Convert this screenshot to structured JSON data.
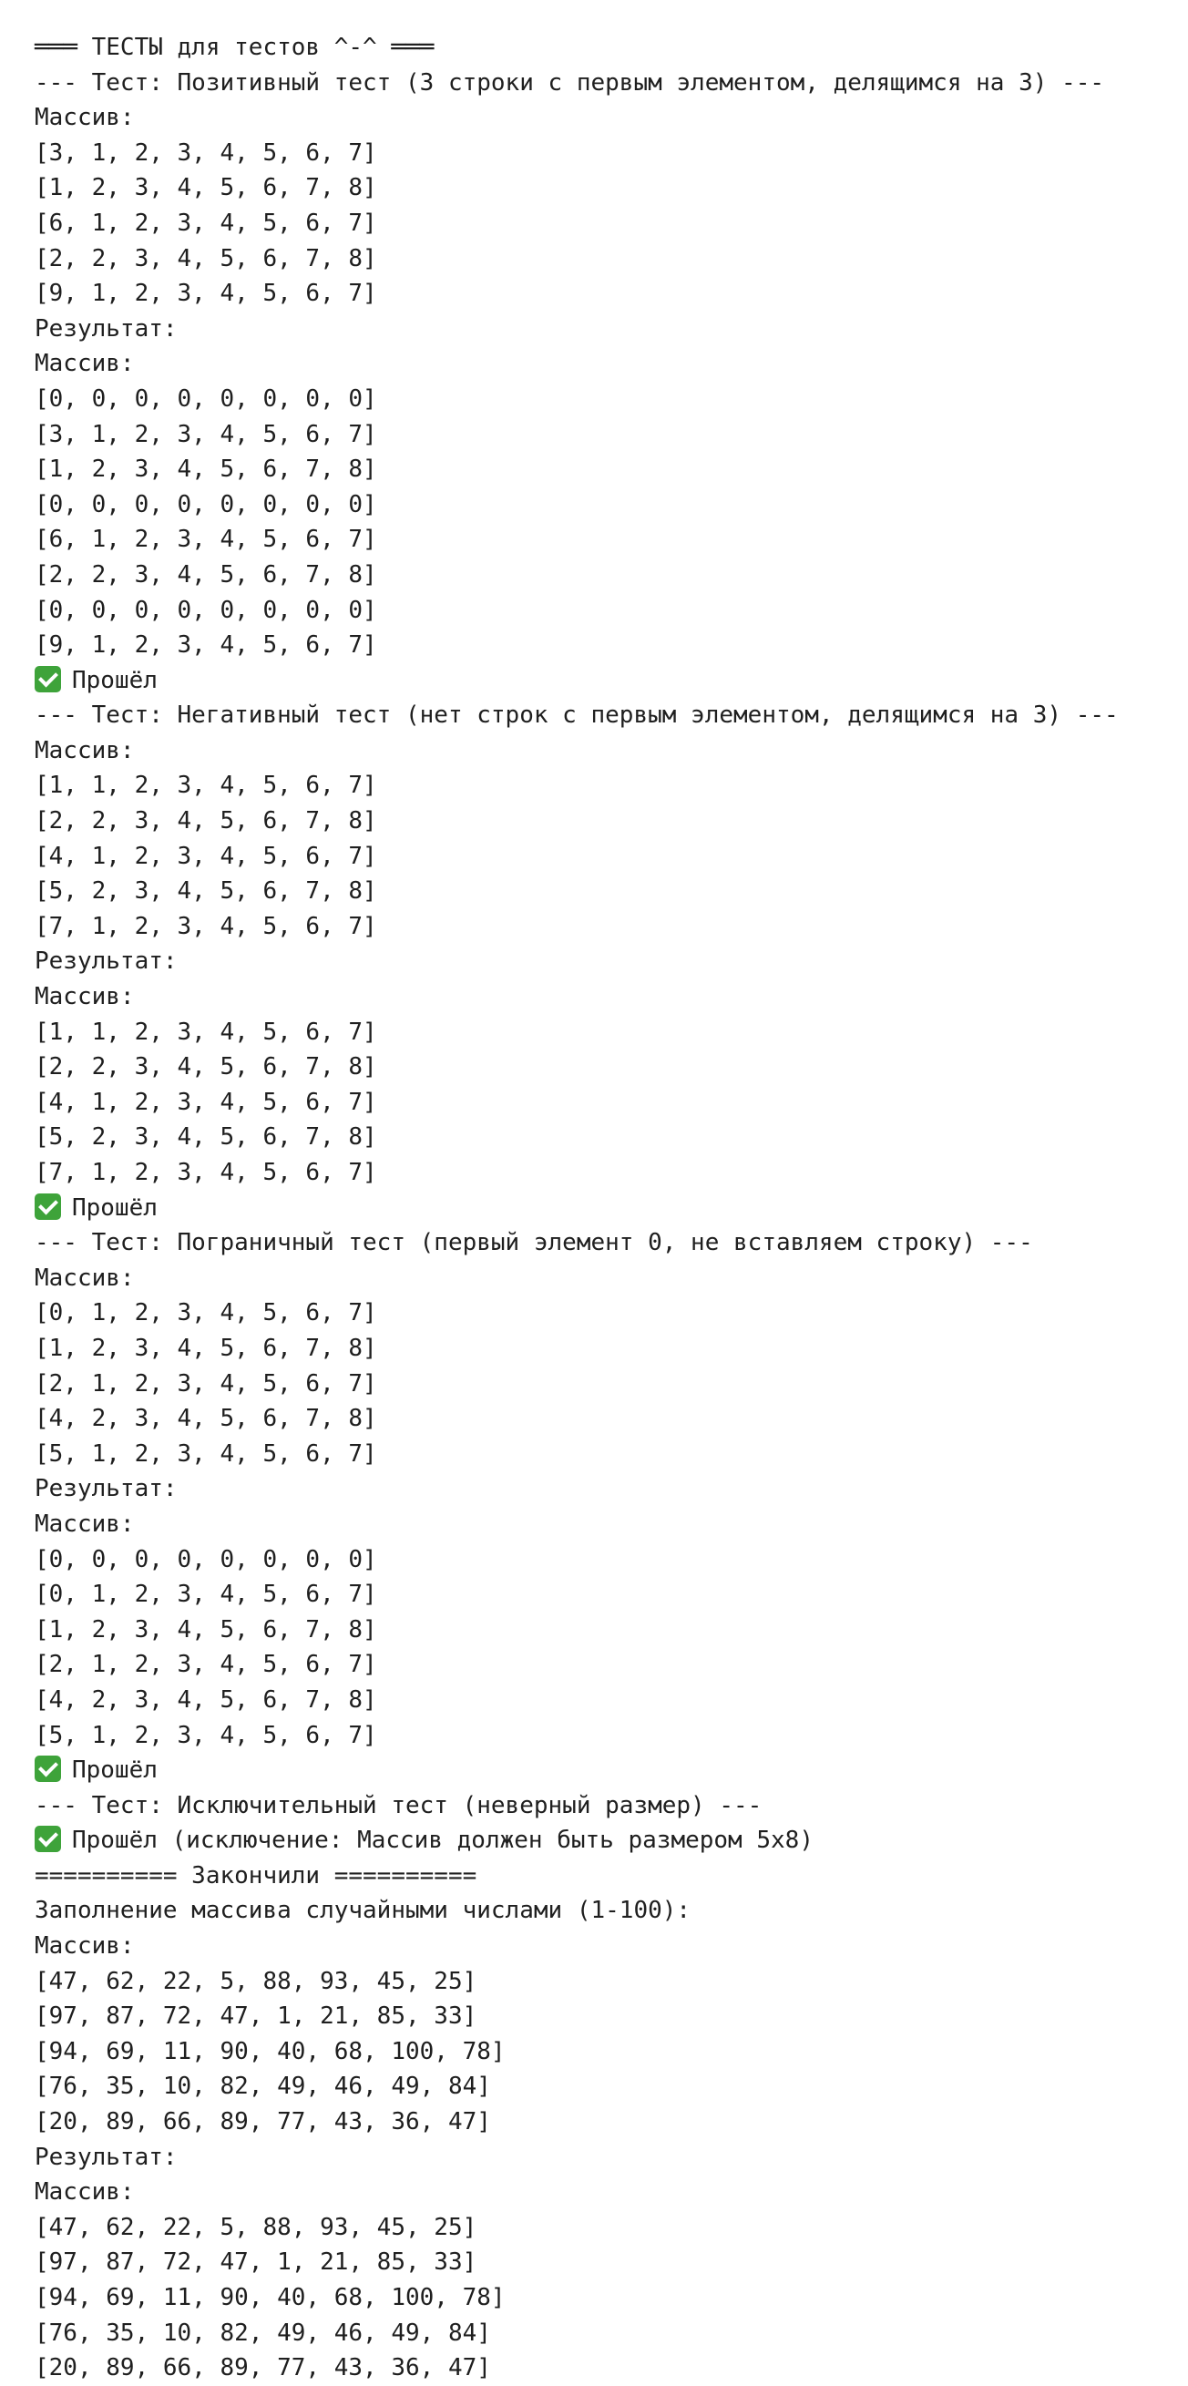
{
  "console": {
    "lines": [
      {
        "text": "═══ ТЕСТЫ для тестов ^-^ ═══",
        "kind": "header"
      },
      {
        "text": "--- Тест: Позитивный тест (3 строки с первым элементом, делящимся на 3) ---",
        "kind": "test-title"
      },
      {
        "text": "Массив:",
        "kind": "label"
      },
      {
        "text": "[3, 1, 2, 3, 4, 5, 6, 7]",
        "kind": "row"
      },
      {
        "text": "[1, 2, 3, 4, 5, 6, 7, 8]",
        "kind": "row"
      },
      {
        "text": "[6, 1, 2, 3, 4, 5, 6, 7]",
        "kind": "row"
      },
      {
        "text": "[2, 2, 3, 4, 5, 6, 7, 8]",
        "kind": "row"
      },
      {
        "text": "[9, 1, 2, 3, 4, 5, 6, 7]",
        "kind": "row"
      },
      {
        "text": "Результат:",
        "kind": "label"
      },
      {
        "text": "Массив:",
        "kind": "label"
      },
      {
        "text": "[0, 0, 0, 0, 0, 0, 0, 0]",
        "kind": "row"
      },
      {
        "text": "[3, 1, 2, 3, 4, 5, 6, 7]",
        "kind": "row"
      },
      {
        "text": "[1, 2, 3, 4, 5, 6, 7, 8]",
        "kind": "row"
      },
      {
        "text": "[0, 0, 0, 0, 0, 0, 0, 0]",
        "kind": "row"
      },
      {
        "text": "[6, 1, 2, 3, 4, 5, 6, 7]",
        "kind": "row"
      },
      {
        "text": "[2, 2, 3, 4, 5, 6, 7, 8]",
        "kind": "row"
      },
      {
        "text": "[0, 0, 0, 0, 0, 0, 0, 0]",
        "kind": "row"
      },
      {
        "text": "[9, 1, 2, 3, 4, 5, 6, 7]",
        "kind": "row"
      },
      {
        "text": "Прошёл",
        "kind": "pass",
        "icon": "check-icon"
      },
      {
        "text": "--- Тест: Негативный тест (нет строк с первым элементом, делящимся на 3) ---",
        "kind": "test-title"
      },
      {
        "text": "Массив:",
        "kind": "label"
      },
      {
        "text": "[1, 1, 2, 3, 4, 5, 6, 7]",
        "kind": "row"
      },
      {
        "text": "[2, 2, 3, 4, 5, 6, 7, 8]",
        "kind": "row"
      },
      {
        "text": "[4, 1, 2, 3, 4, 5, 6, 7]",
        "kind": "row"
      },
      {
        "text": "[5, 2, 3, 4, 5, 6, 7, 8]",
        "kind": "row"
      },
      {
        "text": "[7, 1, 2, 3, 4, 5, 6, 7]",
        "kind": "row"
      },
      {
        "text": "Результат:",
        "kind": "label"
      },
      {
        "text": "Массив:",
        "kind": "label"
      },
      {
        "text": "[1, 1, 2, 3, 4, 5, 6, 7]",
        "kind": "row"
      },
      {
        "text": "[2, 2, 3, 4, 5, 6, 7, 8]",
        "kind": "row"
      },
      {
        "text": "[4, 1, 2, 3, 4, 5, 6, 7]",
        "kind": "row"
      },
      {
        "text": "[5, 2, 3, 4, 5, 6, 7, 8]",
        "kind": "row"
      },
      {
        "text": "[7, 1, 2, 3, 4, 5, 6, 7]",
        "kind": "row"
      },
      {
        "text": "Прошёл",
        "kind": "pass",
        "icon": "check-icon"
      },
      {
        "text": "--- Тест: Пограничный тест (первый элемент 0, не вставляем строку) ---",
        "kind": "test-title"
      },
      {
        "text": "Массив:",
        "kind": "label"
      },
      {
        "text": "[0, 1, 2, 3, 4, 5, 6, 7]",
        "kind": "row"
      },
      {
        "text": "[1, 2, 3, 4, 5, 6, 7, 8]",
        "kind": "row"
      },
      {
        "text": "[2, 1, 2, 3, 4, 5, 6, 7]",
        "kind": "row"
      },
      {
        "text": "[4, 2, 3, 4, 5, 6, 7, 8]",
        "kind": "row"
      },
      {
        "text": "[5, 1, 2, 3, 4, 5, 6, 7]",
        "kind": "row"
      },
      {
        "text": "Результат:",
        "kind": "label"
      },
      {
        "text": "Массив:",
        "kind": "label"
      },
      {
        "text": "[0, 0, 0, 0, 0, 0, 0, 0]",
        "kind": "row"
      },
      {
        "text": "[0, 1, 2, 3, 4, 5, 6, 7]",
        "kind": "row"
      },
      {
        "text": "[1, 2, 3, 4, 5, 6, 7, 8]",
        "kind": "row"
      },
      {
        "text": "[2, 1, 2, 3, 4, 5, 6, 7]",
        "kind": "row"
      },
      {
        "text": "[4, 2, 3, 4, 5, 6, 7, 8]",
        "kind": "row"
      },
      {
        "text": "[5, 1, 2, 3, 4, 5, 6, 7]",
        "kind": "row"
      },
      {
        "text": "Прошёл",
        "kind": "pass",
        "icon": "check-icon"
      },
      {
        "text": "--- Тест: Исключительный тест (неверный размер) ---",
        "kind": "test-title"
      },
      {
        "text": "Прошёл (исключение: Массив должен быть размером 5x8)",
        "kind": "pass",
        "icon": "check-icon"
      },
      {
        "text": "========== Закончили ==========",
        "kind": "header"
      },
      {
        "text": "Заполнение массива случайными числами (1-100):",
        "kind": "label"
      },
      {
        "text": "Массив:",
        "kind": "label"
      },
      {
        "text": "[47, 62, 22, 5, 88, 93, 45, 25]",
        "kind": "row"
      },
      {
        "text": "[97, 87, 72, 47, 1, 21, 85, 33]",
        "kind": "row"
      },
      {
        "text": "[94, 69, 11, 90, 40, 68, 100, 78]",
        "kind": "row"
      },
      {
        "text": "[76, 35, 10, 82, 49, 46, 49, 84]",
        "kind": "row"
      },
      {
        "text": "[20, 89, 66, 89, 77, 43, 36, 47]",
        "kind": "row"
      },
      {
        "text": "Результат:",
        "kind": "label"
      },
      {
        "text": "Массив:",
        "kind": "label"
      },
      {
        "text": "[47, 62, 22, 5, 88, 93, 45, 25]",
        "kind": "row"
      },
      {
        "text": "[97, 87, 72, 47, 1, 21, 85, 33]",
        "kind": "row"
      },
      {
        "text": "[94, 69, 11, 90, 40, 68, 100, 78]",
        "kind": "row"
      },
      {
        "text": "[76, 35, 10, 82, 49, 46, 49, 84]",
        "kind": "row"
      },
      {
        "text": "[20, 89, 66, 89, 77, 43, 36, 47]",
        "kind": "row"
      }
    ]
  },
  "colors": {
    "text": "#1f1f1f",
    "background": "#ffffff",
    "pass_icon": "#3ea33a"
  }
}
